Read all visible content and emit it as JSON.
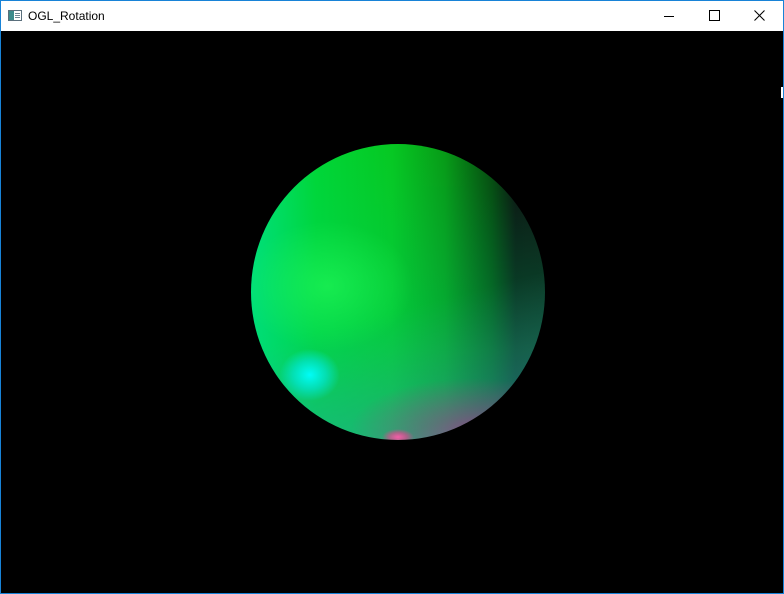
{
  "window": {
    "title": "OGL_Rotation",
    "controls": {
      "minimize": "minimize",
      "maximize": "maximize",
      "close": "close"
    }
  },
  "viewport": {
    "background": "#000000",
    "scene_object": "shaded-sphere",
    "colors": {
      "dominant": "#00d636",
      "highlight_cyan": "#00ffff",
      "highlight_magenta": "#ff5aaa",
      "titlebar": "#ffffff",
      "window_border": "#1883d7"
    }
  }
}
